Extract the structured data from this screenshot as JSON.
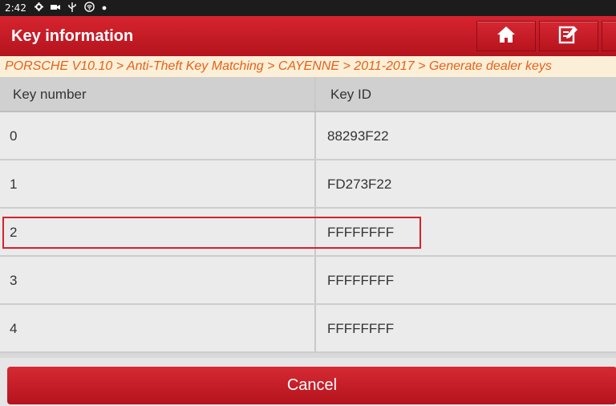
{
  "status_bar": {
    "time": "2:42",
    "icons": [
      "gear-icon",
      "camera-icon",
      "usb-icon",
      "wifi-icon",
      "dot-icon"
    ]
  },
  "title_bar": {
    "title": "Key information",
    "buttons": [
      "home-icon",
      "report-edit-icon"
    ]
  },
  "breadcrumb": "PORSCHE V10.10 > Anti-Theft Key Matching > CAYENNE > 2011-2017 > Generate dealer keys",
  "table": {
    "headers": [
      "Key number",
      "Key ID"
    ],
    "rows": [
      {
        "key_number": "0",
        "key_id": "88293F22"
      },
      {
        "key_number": "1",
        "key_id": "FD273F22"
      },
      {
        "key_number": "2",
        "key_id": "FFFFFFFF"
      },
      {
        "key_number": "3",
        "key_id": "FFFFFFFF"
      },
      {
        "key_number": "4",
        "key_id": "FFFFFFFF"
      }
    ]
  },
  "footer": {
    "cancel_label": "Cancel"
  },
  "colors": {
    "accent_red": "#c41b25",
    "breadcrumb_text": "#e85f1a",
    "breadcrumb_bg": "#fbf0d7"
  }
}
